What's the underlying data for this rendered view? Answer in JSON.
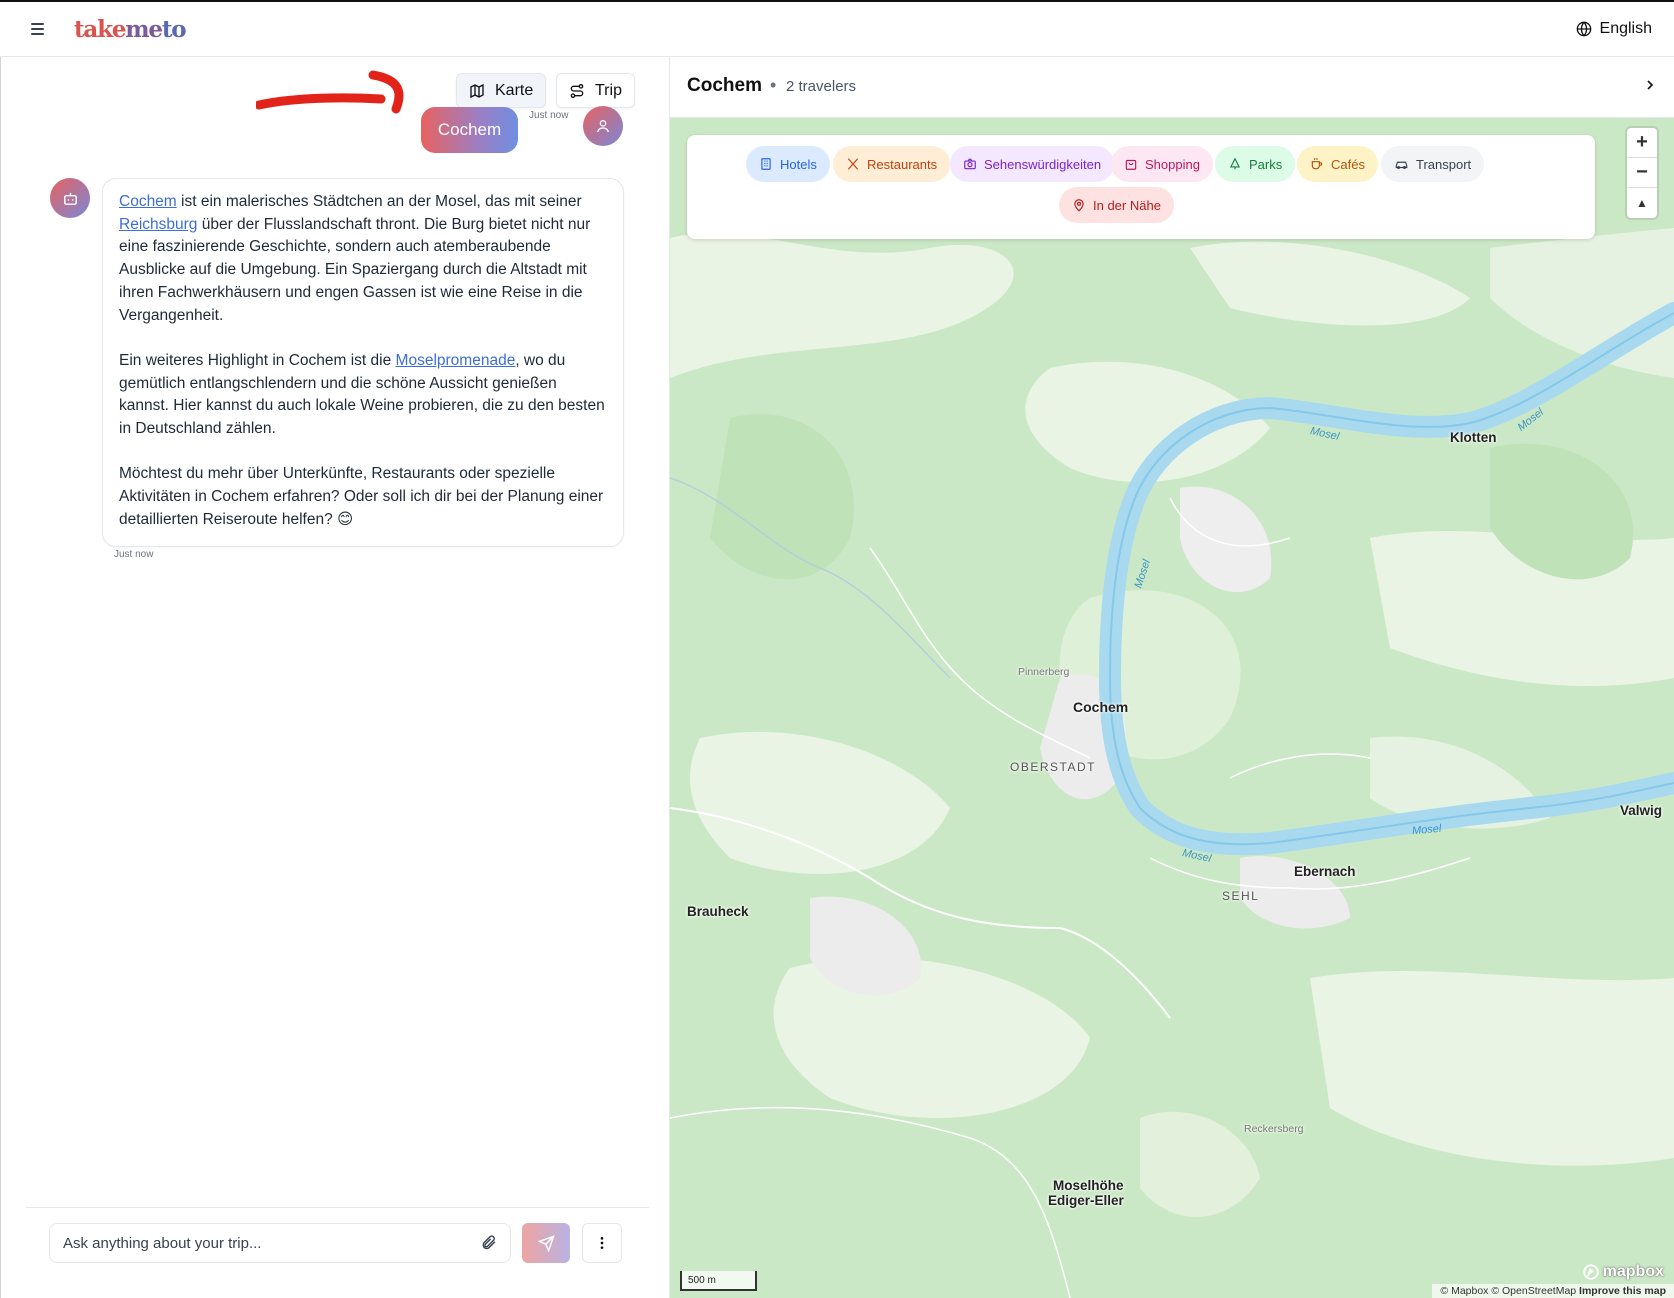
{
  "app": {
    "logo_part1": "take",
    "logo_part2": "me",
    "logo_part3": "to"
  },
  "header": {
    "language": "English"
  },
  "toolbar": {
    "map_label": "Karte",
    "trip_label": "Trip"
  },
  "chat": {
    "user_message": "Cochem",
    "user_time": "Just now",
    "bot_time": "Just now",
    "bot_p1_link1": "Cochem",
    "bot_p1_text1": " ist ein malerisches Städtchen an der Mosel, das mit seiner ",
    "bot_p1_link2": "Reichsburg",
    "bot_p1_text2": " über der Flusslandschaft thront. Die Burg bietet nicht nur eine faszinierende Geschichte, sondern auch atemberaubende Ausblicke auf die Umgebung. Ein Spaziergang durch die Altstadt mit ihren Fachwerkhäusern und engen Gassen ist wie eine Reise in die Vergangenheit.",
    "bot_p2_text1": "Ein weiteres Highlight in Cochem ist die ",
    "bot_p2_link": "Moselpromenade",
    "bot_p2_text2": ", wo du gemütlich entlangschlendern und die schöne Aussicht genießen kannst. Hier kannst du auch lokale Weine probieren, die zu den besten in Deutschland zählen.",
    "bot_p3": "Möchtest du mehr über Unterkünfte, Restaurants oder spezielle Aktivitäten in Cochem erfahren? Oder soll ich dir bei der Planung einer detaillierten Reiseroute helfen? 😊",
    "input_placeholder": "Ask anything about your trip...",
    "input_value": ""
  },
  "map_panel": {
    "title": "Cochem",
    "separator": "•",
    "subtitle": "2 travelers",
    "chips": [
      {
        "label": "Hotels",
        "icon": "building-icon",
        "color": "#2563eb",
        "bg": "#dbeafe"
      },
      {
        "label": "Restaurants",
        "icon": "utensils-icon",
        "color": "#c2410c",
        "bg": "#ffedd5"
      },
      {
        "label": "Sehenswürdigkeiten",
        "icon": "camera-icon",
        "color": "#7e22ce",
        "bg": "#f3e8ff"
      },
      {
        "label": "Shopping",
        "icon": "shopping-bag-icon",
        "color": "#be185d",
        "bg": "#fce7f3"
      },
      {
        "label": "Parks",
        "icon": "tree-icon",
        "color": "#15803d",
        "bg": "#dcfce7"
      },
      {
        "label": "Cafés",
        "icon": "coffee-icon",
        "color": "#b45309",
        "bg": "#fef3c7"
      },
      {
        "label": "Transport",
        "icon": "car-icon",
        "color": "#374151",
        "bg": "#f3f4f6"
      },
      {
        "label": "In der Nähe",
        "icon": "map-pin-icon",
        "color": "#b91c1c",
        "bg": "#fee2e2"
      }
    ],
    "zoom_in": "+",
    "zoom_out": "−",
    "compass": "▲",
    "places": {
      "klotten": "Klotten",
      "cochem": "Cochem",
      "pinnerberg": "Pinnerberg",
      "oberstadt": "OBERSTADT",
      "valwig": "Valwig",
      "ebernach": "Ebernach",
      "sehl": "SEHL",
      "brauheck": "Brauheck",
      "reckersberg": "Reckersberg",
      "moselhoehe1": "Moselhöhe",
      "moselhoehe2": "Ediger-Eller"
    },
    "river": "Mosel",
    "scale": "500 m",
    "mapbox": "mapbox",
    "attribution_1": "© Mapbox © OpenStreetMap ",
    "attribution_2": "Improve this map"
  }
}
